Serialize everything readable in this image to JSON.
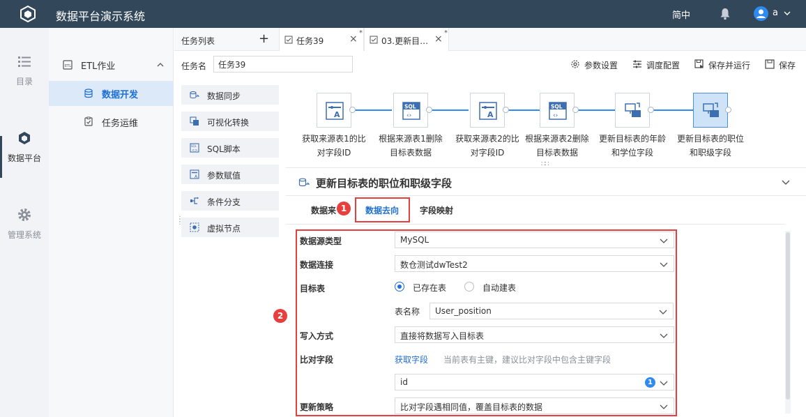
{
  "app": {
    "title": "数据平台演示系统",
    "lang": "简中",
    "user": "a"
  },
  "leftnav": {
    "items": [
      {
        "label": "目录"
      },
      {
        "label": "数据平台"
      },
      {
        "label": "管理系统"
      }
    ]
  },
  "tree": {
    "group": "ETL作业",
    "selected": "数据开发",
    "sub": "任务运维"
  },
  "tabs": {
    "list_label": "任务列表",
    "plus": "+",
    "items": [
      {
        "label": "任务39",
        "close": "×",
        "star": "*"
      },
      {
        "label": "03.更新目…",
        "close": "×",
        "star": "*"
      }
    ]
  },
  "task": {
    "name_label": "任务名",
    "name_value": "任务39"
  },
  "toolbar": {
    "params": "参数设置",
    "schedule": "调度配置",
    "save_run": "保存并运行",
    "save": "保存"
  },
  "palette": [
    {
      "label": "数据同步",
      "icon": "data-sync-icon"
    },
    {
      "label": "可视化转换",
      "icon": "visual-transform-icon"
    },
    {
      "label": "SQL脚本",
      "icon": "sql-icon"
    },
    {
      "label": "参数赋值",
      "icon": "param-assign-icon"
    },
    {
      "label": "条件分支",
      "icon": "branch-icon"
    },
    {
      "label": "虚拟节点",
      "icon": "virtual-node-icon"
    }
  ],
  "flow": {
    "nodes": [
      {
        "line1": "获取来源表1的比",
        "line2": "对字段ID",
        "icon": "param-assign-icon"
      },
      {
        "line1": "根据来源表1删除",
        "line2": "目标表数据",
        "icon": "sql-icon"
      },
      {
        "line1": "获取来源表2的比",
        "line2": "对字段ID",
        "icon": "param-assign-icon"
      },
      {
        "line1": "根据来源表2删除",
        "line2": "目标表数据",
        "icon": "sql-icon"
      },
      {
        "line1": "更新目标表的年龄",
        "line2": "和学位字段",
        "icon": "data-sync-icon"
      },
      {
        "line1": "更新目标表的职位",
        "line2": "和职级字段",
        "icon": "data-sync-icon"
      }
    ],
    "grip": "∷∷"
  },
  "panel": {
    "title": "更新目标表的职位和职级字段",
    "tabs": [
      "数据来",
      "数据去向",
      "字段映射"
    ],
    "markers": [
      "1",
      "2"
    ],
    "form": {
      "source_type_label": "数据源类型",
      "source_type": "MySQL",
      "connection_label": "数据连接",
      "connection": "数仓测试dwTest2",
      "target_label": "目标表",
      "target_opt1": "已存在表",
      "target_opt2": "自动建表",
      "table_name_label": "表名称",
      "table_name": "User_position",
      "write_mode_label": "写入方式",
      "write_mode": "直接将数据写入目标表",
      "compare_label": "比对字段",
      "fetch_fields": "获取字段",
      "compare_hint": "当前表有主键，建议比对字段中包含主键字段",
      "compare_value": "id",
      "compare_count": "1",
      "strategy_label": "更新策略",
      "strategy": "比对字段遇相同值，覆盖目标表的数据"
    }
  }
}
